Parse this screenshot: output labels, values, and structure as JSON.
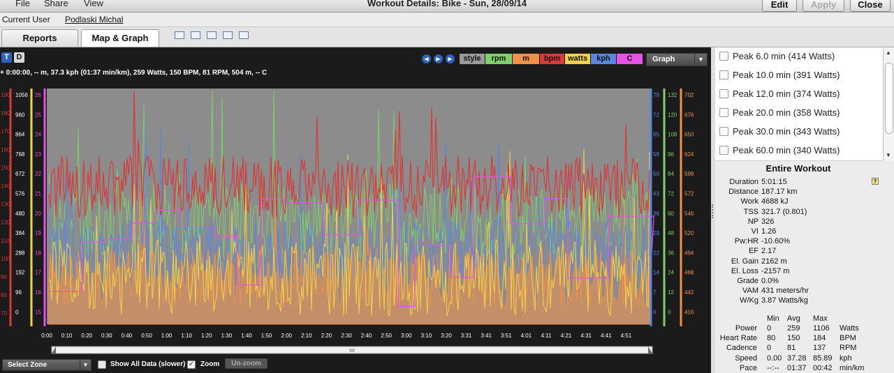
{
  "menu": [
    "File",
    "Share",
    "View"
  ],
  "window_title": "Workout Details: Bike - Sun, 28/09/14",
  "window_buttons": {
    "edit": "Edit",
    "apply": "Apply",
    "close": "Close"
  },
  "user": {
    "label": "Current User",
    "name": "Podlaski Michal"
  },
  "tabs": {
    "reports": "Reports",
    "map_graph": "Map & Graph"
  },
  "toggle": {
    "t": "T",
    "d": "D"
  },
  "info_line": "+ 0:00:00, -- m, 37.3 kph (01:37 min/km), 259 Watts, 150 BPM, 81 RPM, 504 m, -- C",
  "legend": {
    "style": "style",
    "rpm": "rpm",
    "m": "m",
    "bpm": "bpm",
    "watts": "watts",
    "kph": "kph",
    "c": "C",
    "colors": {
      "style": "#9a9a9a",
      "rpm": "#7fcf6a",
      "m": "#f0914a",
      "bpm": "#d83a3a",
      "watts": "#f3d34a",
      "kph": "#5b86e0",
      "c": "#e651e6"
    }
  },
  "graph_select": "Graph",
  "axes": {
    "bpm": [
      "190",
      "180",
      "170",
      "160",
      "150",
      "140",
      "130",
      "120",
      "110",
      "100",
      "90",
      "80",
      "70"
    ],
    "watts": [
      "1056",
      "960",
      "864",
      "768",
      "672",
      "576",
      "480",
      "384",
      "288",
      "192",
      "96",
      "0"
    ],
    "c": [
      "26",
      "25",
      "24",
      "23",
      "22",
      "21",
      "20",
      "19",
      "18",
      "17",
      "16",
      "15"
    ],
    "kph": [
      "79",
      "72",
      "65",
      "58",
      "50",
      "43",
      "36",
      "29",
      "22",
      "14",
      "7",
      "0"
    ],
    "rpm": [
      "132",
      "120",
      "108",
      "96",
      "84",
      "72",
      "60",
      "48",
      "36",
      "24",
      "12",
      "0"
    ],
    "m": [
      "702",
      "676",
      "650",
      "624",
      "598",
      "572",
      "546",
      "520",
      "494",
      "468",
      "442",
      "416"
    ],
    "time": [
      "0:00",
      "0:10",
      "0:20",
      "0:30",
      "0:40",
      "0:50",
      "1:00",
      "1:10",
      "1:20",
      "1:30",
      "1:40",
      "1:50",
      "2:00",
      "2:10",
      "2:20",
      "2:30",
      "2:40",
      "2:50",
      "3:00",
      "3:10",
      "3:20",
      "3:31",
      "3:41",
      "3:51",
      "4:01",
      "4:11",
      "4:21",
      "4:31",
      "4:41",
      "4:51"
    ]
  },
  "controls": {
    "select_zone": "Select Zone",
    "show_all": "Show All Data (slower)",
    "zoom": "Zoom",
    "unzoom": "Un-zoom"
  },
  "peaks": [
    "Peak  6.0 min (414 Watts)",
    "Peak  10.0 min (391 Watts)",
    "Peak  12.0 min (374 Watts)",
    "Peak  20.0 min (358 Watts)",
    "Peak  30.0 min (343 Watts)",
    "Peak  60.0 min (340 Watts)"
  ],
  "entire_workout": {
    "title": "Entire Workout",
    "help": "?",
    "stats": [
      {
        "k": "Duration",
        "v": "5:01:15"
      },
      {
        "k": "Distance",
        "v": "187.17 km"
      },
      {
        "k": "Work",
        "v": "4688 kJ"
      },
      {
        "k": "TSS",
        "v": "321.7 (0.801)"
      },
      {
        "k": "NP",
        "v": "326"
      },
      {
        "k": "VI",
        "v": "1.26"
      },
      {
        "k": "Pw:HR",
        "v": "-10.60%"
      },
      {
        "k": "EF",
        "v": "2.17"
      },
      {
        "k": "El. Gain",
        "v": "2162 m"
      },
      {
        "k": "El. Loss",
        "v": "-2157 m"
      },
      {
        "k": "Grade",
        "v": "0.0%"
      },
      {
        "k": "VAM",
        "v": "431 meters/hr"
      },
      {
        "k": "W/Kg",
        "v": "3.87 Watts/kg"
      }
    ],
    "table_headers": [
      "Min",
      "Avg",
      "Max"
    ],
    "table_rows": [
      {
        "label": "Power",
        "min": "0",
        "avg": "259",
        "max": "1106",
        "unit": "Watts"
      },
      {
        "label": "Heart Rate",
        "min": "80",
        "avg": "150",
        "max": "184",
        "unit": "BPM"
      },
      {
        "label": "Cadence",
        "min": "0",
        "avg": "81",
        "max": "137",
        "unit": "RPM"
      },
      {
        "label": "Speed",
        "min": "0.00",
        "avg": "37.28",
        "max": "85.89",
        "unit": "kph"
      },
      {
        "label": "Pace",
        "min": "--:--",
        "avg": "01:37",
        "max": "00:42",
        "unit": "min/km"
      }
    ]
  }
}
